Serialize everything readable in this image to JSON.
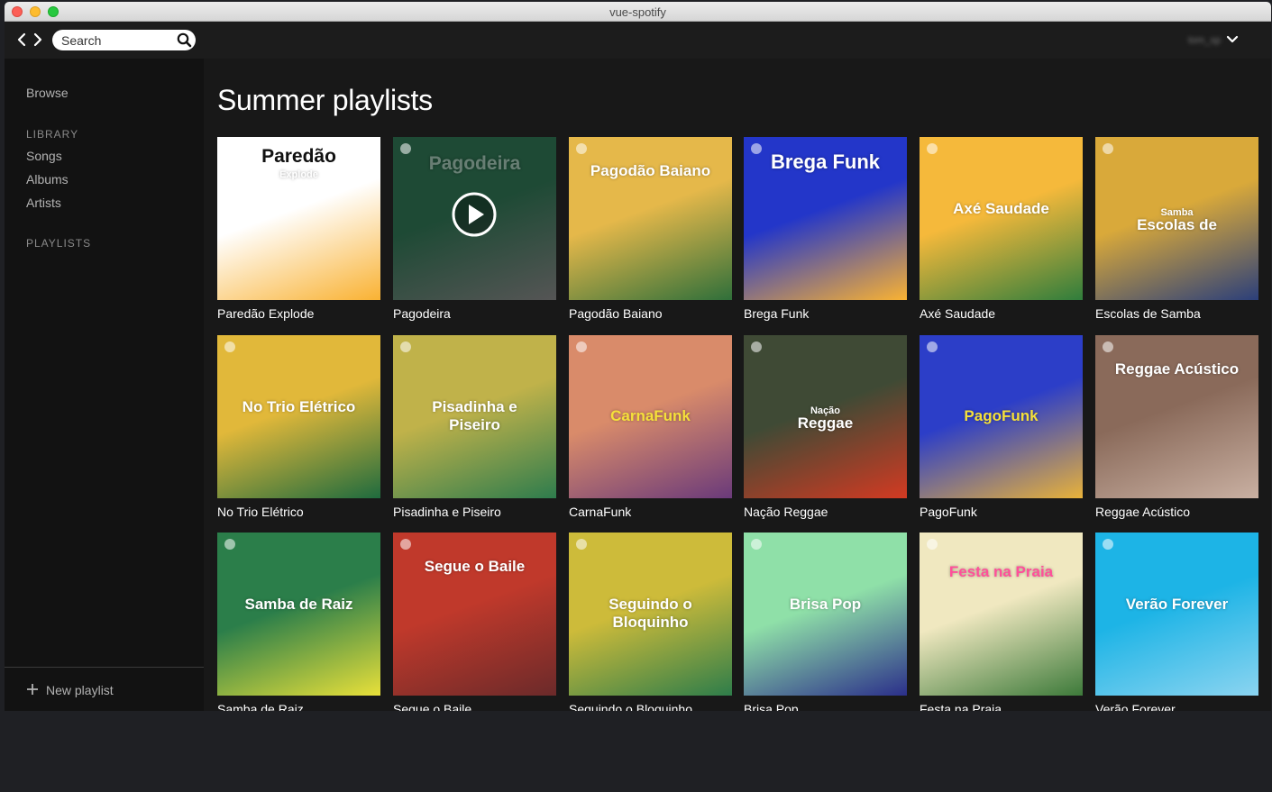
{
  "window": {
    "title": "vue-spotify"
  },
  "search": {
    "placeholder": "Search"
  },
  "user": {
    "name": "tom_sp"
  },
  "sidebar": {
    "browse": "Browse",
    "library_heading": "LIBRARY",
    "library_items": [
      "Songs",
      "Albums",
      "Artists"
    ],
    "playlists_heading": "PLAYLISTS",
    "new_playlist": "New playlist"
  },
  "main": {
    "title": "Summer playlists",
    "playlists": [
      {
        "name": "Paredão Explode",
        "cover_title": "Paredão",
        "cover_subtitle": "Explode",
        "colors": [
          "#ffffff",
          "#f9b233"
        ]
      },
      {
        "name": "Pagodeira",
        "cover_title": "Pagodeira",
        "colors": [
          "#1e4a35",
          "#555555"
        ]
      },
      {
        "name": "Pagodão Baiano",
        "cover_title": "Pagodão Baiano",
        "colors": [
          "#e5b84a",
          "#2f6f3a"
        ]
      },
      {
        "name": "Brega Funk",
        "cover_title": "Brega Funk",
        "colors": [
          "#2336c9",
          "#f9b233"
        ]
      },
      {
        "name": "Axé Saudade",
        "cover_title": "Axé Saudade",
        "colors": [
          "#f5b93b",
          "#2f7d3c"
        ]
      },
      {
        "name": "Escolas de Samba",
        "cover_title": "Escolas de",
        "cover_subtitle": "Samba",
        "colors": [
          "#d9a93a",
          "#2b3f7a"
        ]
      },
      {
        "name": "No Trio Elétrico",
        "cover_title": "No Trio Elétrico",
        "colors": [
          "#e1b83a",
          "#1f6b3e"
        ]
      },
      {
        "name": "Pisadinha e Piseiro",
        "cover_title": "Pisadinha e Piseiro",
        "colors": [
          "#c0b24a",
          "#2e7c4d"
        ]
      },
      {
        "name": "CarnaFunk",
        "cover_title": "CarnaFunk",
        "colors": [
          "#d98b6a",
          "#6a3a7a"
        ]
      },
      {
        "name": "Nação Reggae",
        "cover_title": "Reggae",
        "cover_subtitle": "Nação",
        "colors": [
          "#3f4a35",
          "#d33a22"
        ]
      },
      {
        "name": "PagoFunk",
        "cover_title": "PagoFunk",
        "colors": [
          "#2c3ec8",
          "#e8b23a"
        ]
      },
      {
        "name": "Reggae Acústico",
        "cover_title": "Reggae Acústico",
        "colors": [
          "#8a6a5a",
          "#c9b0a2"
        ]
      },
      {
        "name": "Samba de Raiz",
        "cover_title": "Samba de Raiz",
        "colors": [
          "#2b7e4a",
          "#e8e03a"
        ]
      },
      {
        "name": "Segue o Baile",
        "cover_title": "Segue o Baile",
        "colors": [
          "#c0392b",
          "#6b2a2a"
        ]
      },
      {
        "name": "Seguindo o Bloquinho",
        "cover_title": "Seguindo o Bloquinho",
        "colors": [
          "#cdbb3a",
          "#2e7d4a"
        ]
      },
      {
        "name": "Brisa Pop",
        "cover_title": "Brisa Pop",
        "colors": [
          "#8fe0a8",
          "#2b2f8a"
        ]
      },
      {
        "name": "Festa na Praia",
        "cover_title": "Festa na Praia",
        "colors": [
          "#f0e8c0",
          "#3d7a3a"
        ]
      },
      {
        "name": "Verão Forever",
        "cover_title": "Verão Forever",
        "colors": [
          "#1db4e6",
          "#8bd4f0"
        ]
      }
    ]
  },
  "colors": {
    "accent_green": "#1db954",
    "highlight_yellow": "#f5e03a",
    "highlight_pink": "#ff4f9a"
  }
}
